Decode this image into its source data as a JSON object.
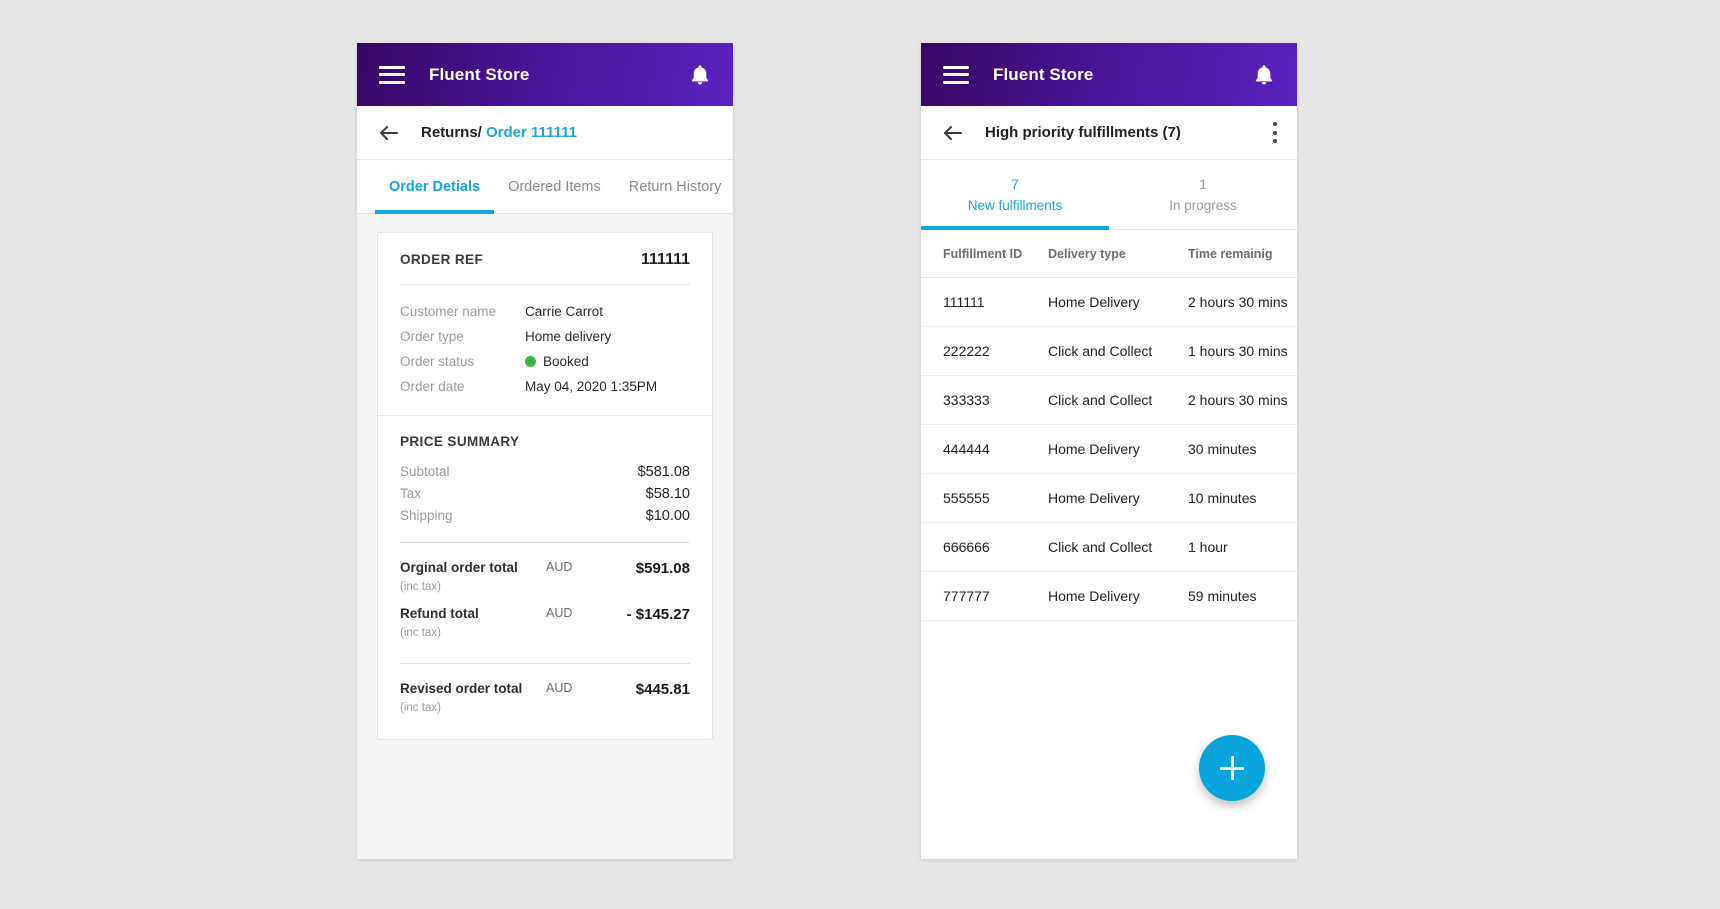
{
  "app": {
    "title": "Fluent Store",
    "menu_icon": "hamburger-icon",
    "bell_icon": "bell-icon",
    "back_icon": "back-arrow-icon",
    "kebab_icon": "more-vertical-icon",
    "brand_gradient_from": "#380764",
    "brand_gradient_to": "#5a22bf",
    "accent": "#14a5e0",
    "urgent_color": "#e24d4d",
    "status_color": "#3cb34a"
  },
  "left_screen": {
    "breadcrumb": {
      "parent": "Returns/",
      "current": "Order 111111"
    },
    "tabs": [
      {
        "label": "Order Detials",
        "active": true
      },
      {
        "label": "Ordered Items",
        "active": false
      },
      {
        "label": "Return History",
        "active": false
      }
    ],
    "order_ref": {
      "label": "ORDER REF",
      "value": "111111"
    },
    "details": [
      {
        "label": "Customer name",
        "value": "Carrie Carrot",
        "has_dot": false
      },
      {
        "label": "Order type",
        "value": "Home delivery",
        "has_dot": false
      },
      {
        "label": "Order status",
        "value": "Booked",
        "has_dot": true
      },
      {
        "label": "Order date",
        "value": "May 04, 2020 1:35PM",
        "has_dot": false
      }
    ],
    "price_summary": {
      "title": "PRICE SUMMARY",
      "lines": [
        {
          "label": "Subtotal",
          "value": "$581.08"
        },
        {
          "label": "Tax",
          "value": "$58.10"
        },
        {
          "label": "Shipping",
          "value": "$10.00"
        }
      ],
      "totals": [
        {
          "label": "Orginal order total",
          "sub": "(inc tax)",
          "currency": "AUD",
          "value": "$591.08"
        },
        {
          "label": "Refund total",
          "sub": "(inc tax)",
          "currency": "AUD",
          "value": "- $145.27"
        }
      ],
      "revised": {
        "label": "Revised order total",
        "sub": "(inc tax)",
        "currency": "AUD",
        "value": "$445.81"
      }
    }
  },
  "right_screen": {
    "title": "High priority fulfillments (7)",
    "tabs": [
      {
        "count": "7",
        "label": "New fulfillments",
        "active": true
      },
      {
        "count": "1",
        "label": "In progress",
        "active": false
      }
    ],
    "table": {
      "headers": [
        "Fulfillment ID",
        "Delivery type",
        "Time remainig"
      ],
      "rows": [
        {
          "id": "111111",
          "type": "Home Delivery",
          "time": "2 hours 30 mins",
          "urgent": false
        },
        {
          "id": "222222",
          "type": "Click and Collect",
          "time": "1 hours 30 mins",
          "urgent": false
        },
        {
          "id": "333333",
          "type": "Click and Collect",
          "time": "2 hours 30 mins",
          "urgent": false
        },
        {
          "id": "444444",
          "type": "Home Delivery",
          "time": "30 minutes",
          "urgent": true
        },
        {
          "id": "555555",
          "type": "Home Delivery",
          "time": "10 minutes",
          "urgent": true
        },
        {
          "id": "666666",
          "type": "Click and Collect",
          "time": "1 hour",
          "urgent": false
        },
        {
          "id": "777777",
          "type": "Home Delivery",
          "time": "59 minutes",
          "urgent": true
        }
      ]
    },
    "fab": {
      "icon": "plus-icon",
      "label": "+"
    }
  }
}
